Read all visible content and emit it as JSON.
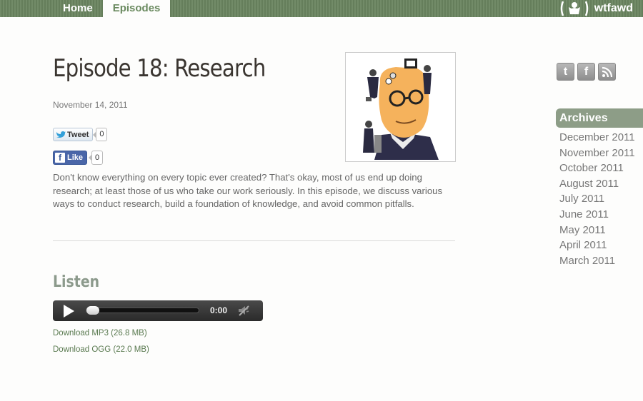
{
  "nav": {
    "home": "Home",
    "episodes": "Episodes"
  },
  "brand": {
    "name": "wtfawd"
  },
  "episode": {
    "title": "Episode 18: Research",
    "date": "November 14, 2011",
    "description": "Don't know everything on every topic ever created? That's okay, most of us end up doing research; at least those of us who take our work seriously. In this episode, we discuss various ways to conduct research, build a foundation of knowledge, and avoid common pitfalls."
  },
  "share": {
    "tweet_label": "Tweet",
    "tweet_count": "0",
    "like_label": "Like",
    "like_count": "0"
  },
  "listen": {
    "heading": "Listen",
    "time": "0:00",
    "progress": 0,
    "download_mp3": "Download MP3 (26.8 MB)",
    "download_ogg": "Download OGG (22.0 MB)"
  },
  "sidebar": {
    "social_icons": [
      "twitter-icon",
      "facebook-icon",
      "rss-icon"
    ],
    "archives_heading": "Archives",
    "archives": [
      "December 2011",
      "November 2011",
      "October 2011",
      "August 2011",
      "July 2011",
      "June 2011",
      "May 2011",
      "April 2011",
      "March 2011"
    ]
  },
  "colors": {
    "topbar": "#6a8560",
    "accent": "#8d9d87",
    "link": "#5a7a50"
  }
}
